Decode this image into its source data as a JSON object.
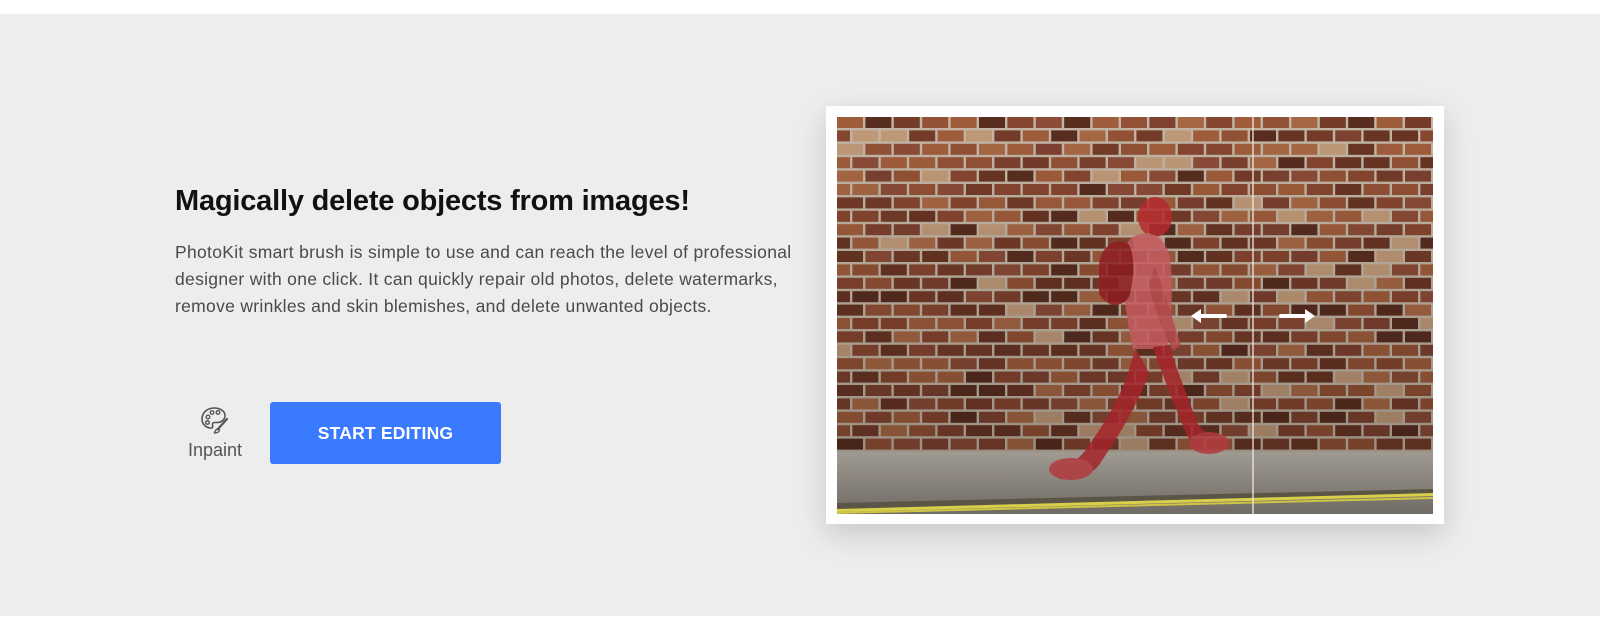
{
  "hero": {
    "title": "Magically delete objects from images!",
    "description": "PhotoKit smart brush is simple to use and can reach the level of professional designer with one click. It can quickly repair old photos, delete watermarks, remove wrinkles and skin blemishes, and delete unwanted objects.",
    "tool": {
      "label": "Inpaint",
      "icon": "palette-brush-icon"
    },
    "cta_label": "START EDITING"
  },
  "preview": {
    "compare_icons": [
      "arrow-left-icon",
      "arrow-right-icon"
    ],
    "mask_label_icon": "none"
  },
  "colors": {
    "background": "#ededed",
    "accent": "#3a7afe",
    "mask": "#c0272d",
    "brick": "#8e4a32",
    "mortar": "#cdbfae"
  }
}
